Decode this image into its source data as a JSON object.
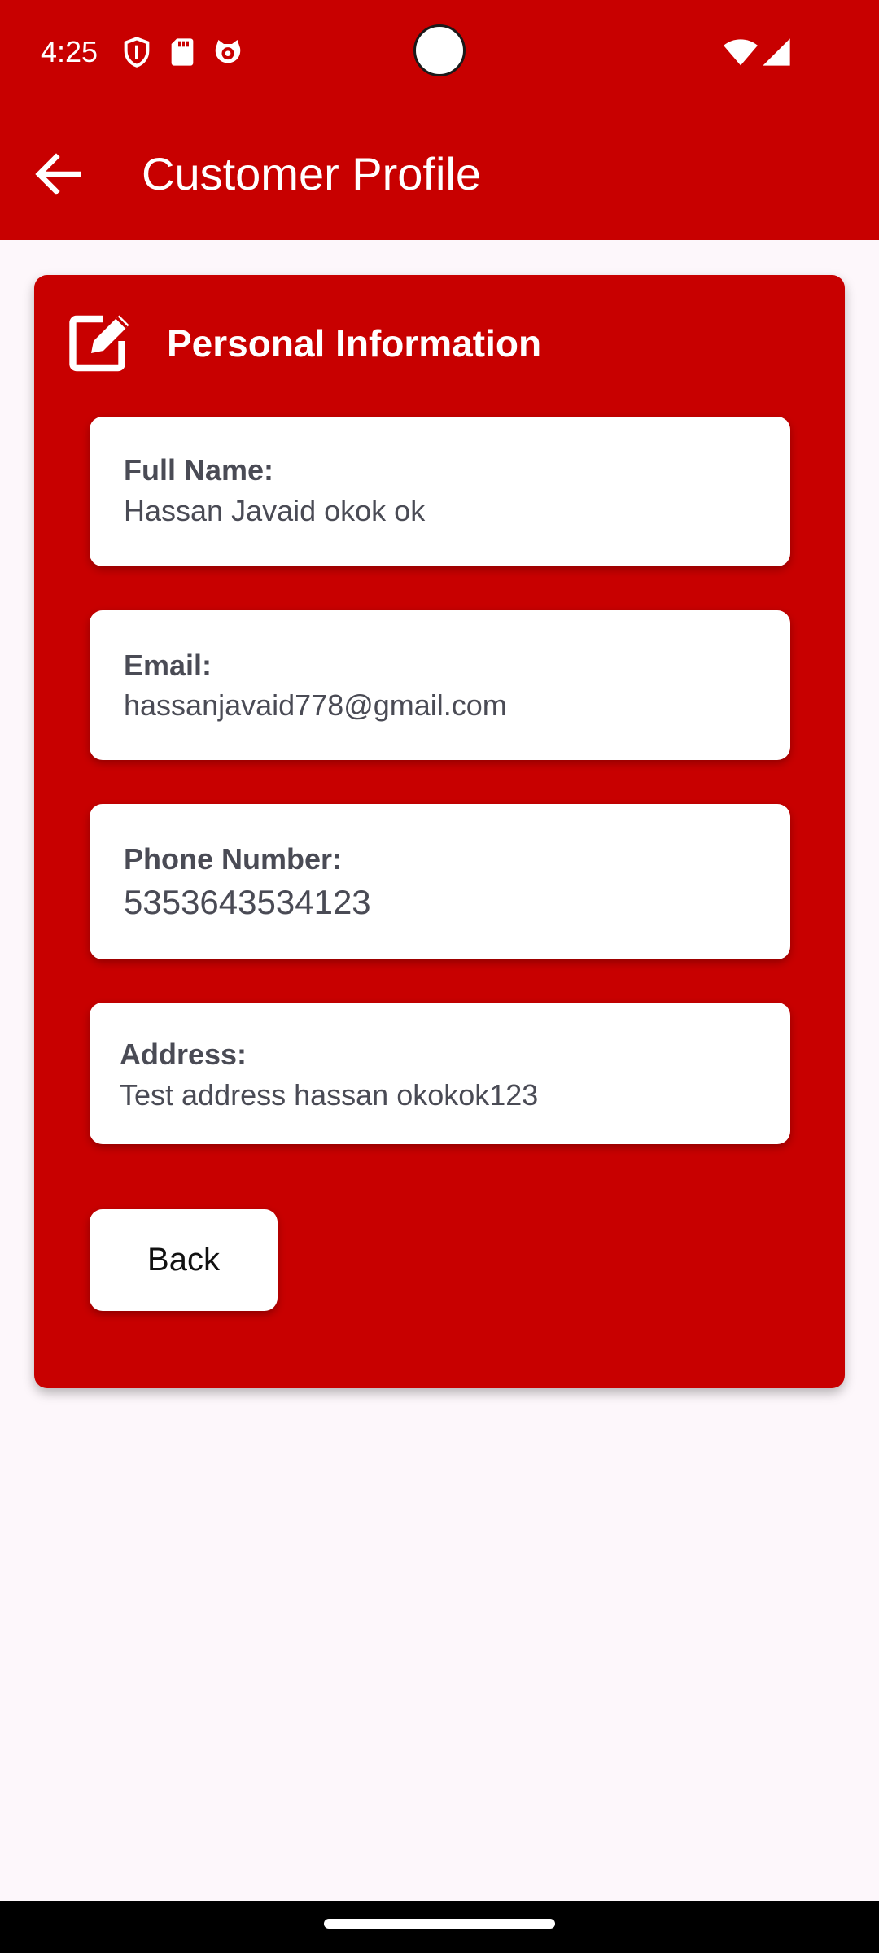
{
  "status_bar": {
    "time": "4:25",
    "left_icons": [
      "shield-icon",
      "sd-card-icon",
      "cat-face-icon"
    ],
    "right_icons": [
      "wifi-icon",
      "cellular-signal-icon"
    ]
  },
  "app_bar": {
    "title": "Customer Profile",
    "back_icon": "arrow-left-icon"
  },
  "card": {
    "title": "Personal Information",
    "header_icon": "edit-icon",
    "fields": [
      {
        "label": "Full Name:",
        "value": "Hassan Javaid  okok ok"
      },
      {
        "label": "Email:",
        "value": "hassanjavaid778@gmail.com"
      },
      {
        "label": "Phone Number:",
        "value": "5353643534123"
      },
      {
        "label": "Address:",
        "value": "Test address hassan okokok123"
      }
    ],
    "back_button_label": "Back"
  },
  "colors": {
    "primary": "#c80000",
    "background": "#fdf7fb",
    "text": "#4a4b55",
    "surface": "#ffffff"
  }
}
